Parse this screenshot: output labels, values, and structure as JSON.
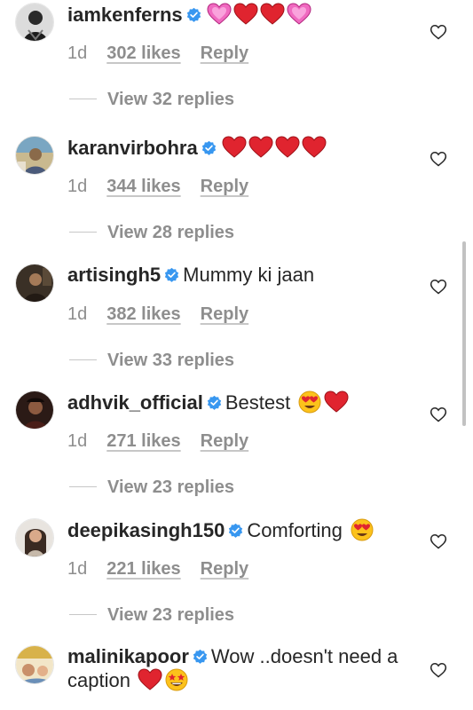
{
  "comments": [
    {
      "username": "iamkenferns",
      "text": "",
      "emojis": [
        "pink-heart",
        "red-heart",
        "red-heart",
        "pink-heart"
      ],
      "time": "1d",
      "likes": "302 likes",
      "reply": "Reply",
      "view_replies": "View 32 replies"
    },
    {
      "username": "karanvirbohra",
      "text": "",
      "emojis": [
        "red-heart",
        "red-heart",
        "red-heart",
        "red-heart"
      ],
      "time": "1d",
      "likes": "344 likes",
      "reply": "Reply",
      "view_replies": "View 28 replies"
    },
    {
      "username": "artisingh5",
      "text": "Mummy ki jaan",
      "emojis": [],
      "time": "1d",
      "likes": "382 likes",
      "reply": "Reply",
      "view_replies": "View 33 replies"
    },
    {
      "username": "adhvik_official",
      "text": "Bestest",
      "emojis": [
        "heart-eyes",
        "red-heart"
      ],
      "time": "1d",
      "likes": "271 likes",
      "reply": "Reply",
      "view_replies": "View 23 replies"
    },
    {
      "username": "deepikasingh150",
      "text": "Comforting",
      "emojis": [
        "heart-eyes"
      ],
      "time": "1d",
      "likes": "221 likes",
      "reply": "Reply",
      "view_replies": "View 23 replies"
    },
    {
      "username": "malinikapoor",
      "text": "Wow ..doesn't need a caption",
      "emojis": [
        "red-heart",
        "star-struck"
      ],
      "time": "",
      "likes": "",
      "reply": "",
      "view_replies": ""
    }
  ],
  "colors": {
    "text": "#262626",
    "secondary": "#8e8e8e",
    "verified": "#3897f0",
    "heart_red": "#e0242f",
    "heart_pink": "#f06ac0"
  }
}
